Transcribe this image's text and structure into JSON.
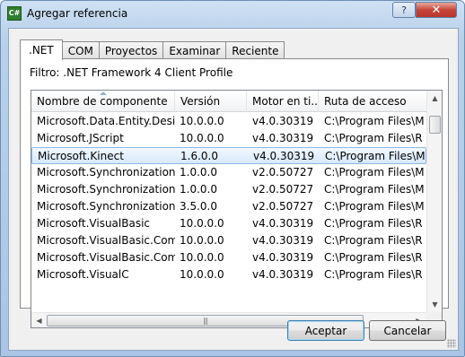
{
  "window": {
    "title": "Agregar referencia",
    "icon_text": "C#",
    "help_button": "?",
    "close_button": "✕"
  },
  "tabs": [
    {
      "label": ".NET",
      "active": true
    },
    {
      "label": "COM"
    },
    {
      "label": "Proyectos"
    },
    {
      "label": "Examinar"
    },
    {
      "label": "Reciente"
    }
  ],
  "filter": "Filtro: .NET Framework 4 Client Profile",
  "columns": [
    "Nombre de componente",
    "Versión",
    "Motor en ti...",
    "Ruta de acceso"
  ],
  "rows": [
    {
      "name": "Microsoft.Data.Entity.Desi...",
      "version": "10.0.0.0",
      "runtime": "v4.0.30319",
      "path": "C:\\Program Files\\M"
    },
    {
      "name": "Microsoft.JScript",
      "version": "10.0.0.0",
      "runtime": "v4.0.30319",
      "path": "C:\\Program Files\\R"
    },
    {
      "name": "Microsoft.Kinect",
      "version": "1.6.0.0",
      "runtime": "v4.0.30319",
      "path": "C:\\Program Files\\M",
      "selected": true
    },
    {
      "name": "Microsoft.Synchronization....",
      "version": "1.0.0.0",
      "runtime": "v2.0.50727",
      "path": "C:\\Program Files\\M"
    },
    {
      "name": "Microsoft.Synchronization....",
      "version": "1.0.0.0",
      "runtime": "v2.0.50727",
      "path": "C:\\Program Files\\M"
    },
    {
      "name": "Microsoft.Synchronization....",
      "version": "3.5.0.0",
      "runtime": "v2.0.50727",
      "path": "C:\\Program Files\\M"
    },
    {
      "name": "Microsoft.VisualBasic",
      "version": "10.0.0.0",
      "runtime": "v4.0.30319",
      "path": "C:\\Program Files\\R"
    },
    {
      "name": "Microsoft.VisualBasic.Com...",
      "version": "10.0.0.0",
      "runtime": "v4.0.30319",
      "path": "C:\\Program Files\\R"
    },
    {
      "name": "Microsoft.VisualBasic.Com...",
      "version": "10.0.0.0",
      "runtime": "v4.0.30319",
      "path": "C:\\Program Files\\R"
    },
    {
      "name": "Microsoft.VisualC",
      "version": "10.0.0.0",
      "runtime": "v4.0.30319",
      "path": "C:\\Program Files\\R"
    }
  ],
  "buttons": {
    "ok": "Aceptar",
    "cancel": "Cancelar"
  }
}
